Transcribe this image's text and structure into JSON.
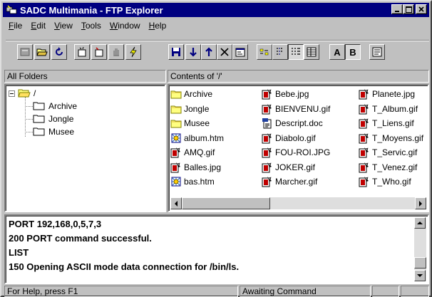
{
  "window": {
    "title": "SADC Multimania - FTP Explorer"
  },
  "menu": [
    {
      "label": "File",
      "hot": "F"
    },
    {
      "label": "Edit",
      "hot": "E"
    },
    {
      "label": "View",
      "hot": "V"
    },
    {
      "label": "Tools",
      "hot": "T"
    },
    {
      "label": "Window",
      "hot": "W"
    },
    {
      "label": "Help",
      "hot": "H"
    }
  ],
  "toolbar": {
    "font_a": "A",
    "font_b": "B"
  },
  "panes": {
    "folders_header": "All Folders",
    "contents_header": "Contents of '/'"
  },
  "tree": {
    "root": "/",
    "children": [
      "Archive",
      "Jongle",
      "Musee"
    ]
  },
  "files": [
    {
      "name": "Archive",
      "icon": "folder-icon"
    },
    {
      "name": "Jongle",
      "icon": "folder-icon"
    },
    {
      "name": "Musee",
      "icon": "folder-icon"
    },
    {
      "name": "album.htm",
      "icon": "html-file-icon"
    },
    {
      "name": "AMQ.gif",
      "icon": "image-file-icon"
    },
    {
      "name": "Balles.jpg",
      "icon": "image-file-icon"
    },
    {
      "name": "bas.htm",
      "icon": "html-file-icon"
    },
    {
      "name": "Bebe.jpg",
      "icon": "image-file-icon"
    },
    {
      "name": "BIENVENU.gif",
      "icon": "image-file-icon"
    },
    {
      "name": "Descript.doc",
      "icon": "document-file-icon"
    },
    {
      "name": "Diabolo.gif",
      "icon": "image-file-icon"
    },
    {
      "name": "FOU-ROI.JPG",
      "icon": "image-file-icon"
    },
    {
      "name": "JOKER.gif",
      "icon": "image-file-icon"
    },
    {
      "name": "Marcher.gif",
      "icon": "image-file-icon"
    },
    {
      "name": "Planete.jpg",
      "icon": "image-file-icon"
    },
    {
      "name": "T_Album.gif",
      "icon": "image-file-icon"
    },
    {
      "name": "T_Liens.gif",
      "icon": "image-file-icon"
    },
    {
      "name": "T_Moyens.gif",
      "icon": "image-file-icon"
    },
    {
      "name": "T_Servic.gif",
      "icon": "image-file-icon"
    },
    {
      "name": "T_Venez.gif",
      "icon": "image-file-icon"
    },
    {
      "name": "T_Who.gif",
      "icon": "image-file-icon"
    }
  ],
  "log": [
    "PORT 192,168,0,5,7,3",
    "200 PORT command successful.",
    "LIST",
    "150 Opening ASCII mode data connection for /bin/ls."
  ],
  "status": {
    "help": "For Help, press F1",
    "state": "Awaiting Command"
  }
}
